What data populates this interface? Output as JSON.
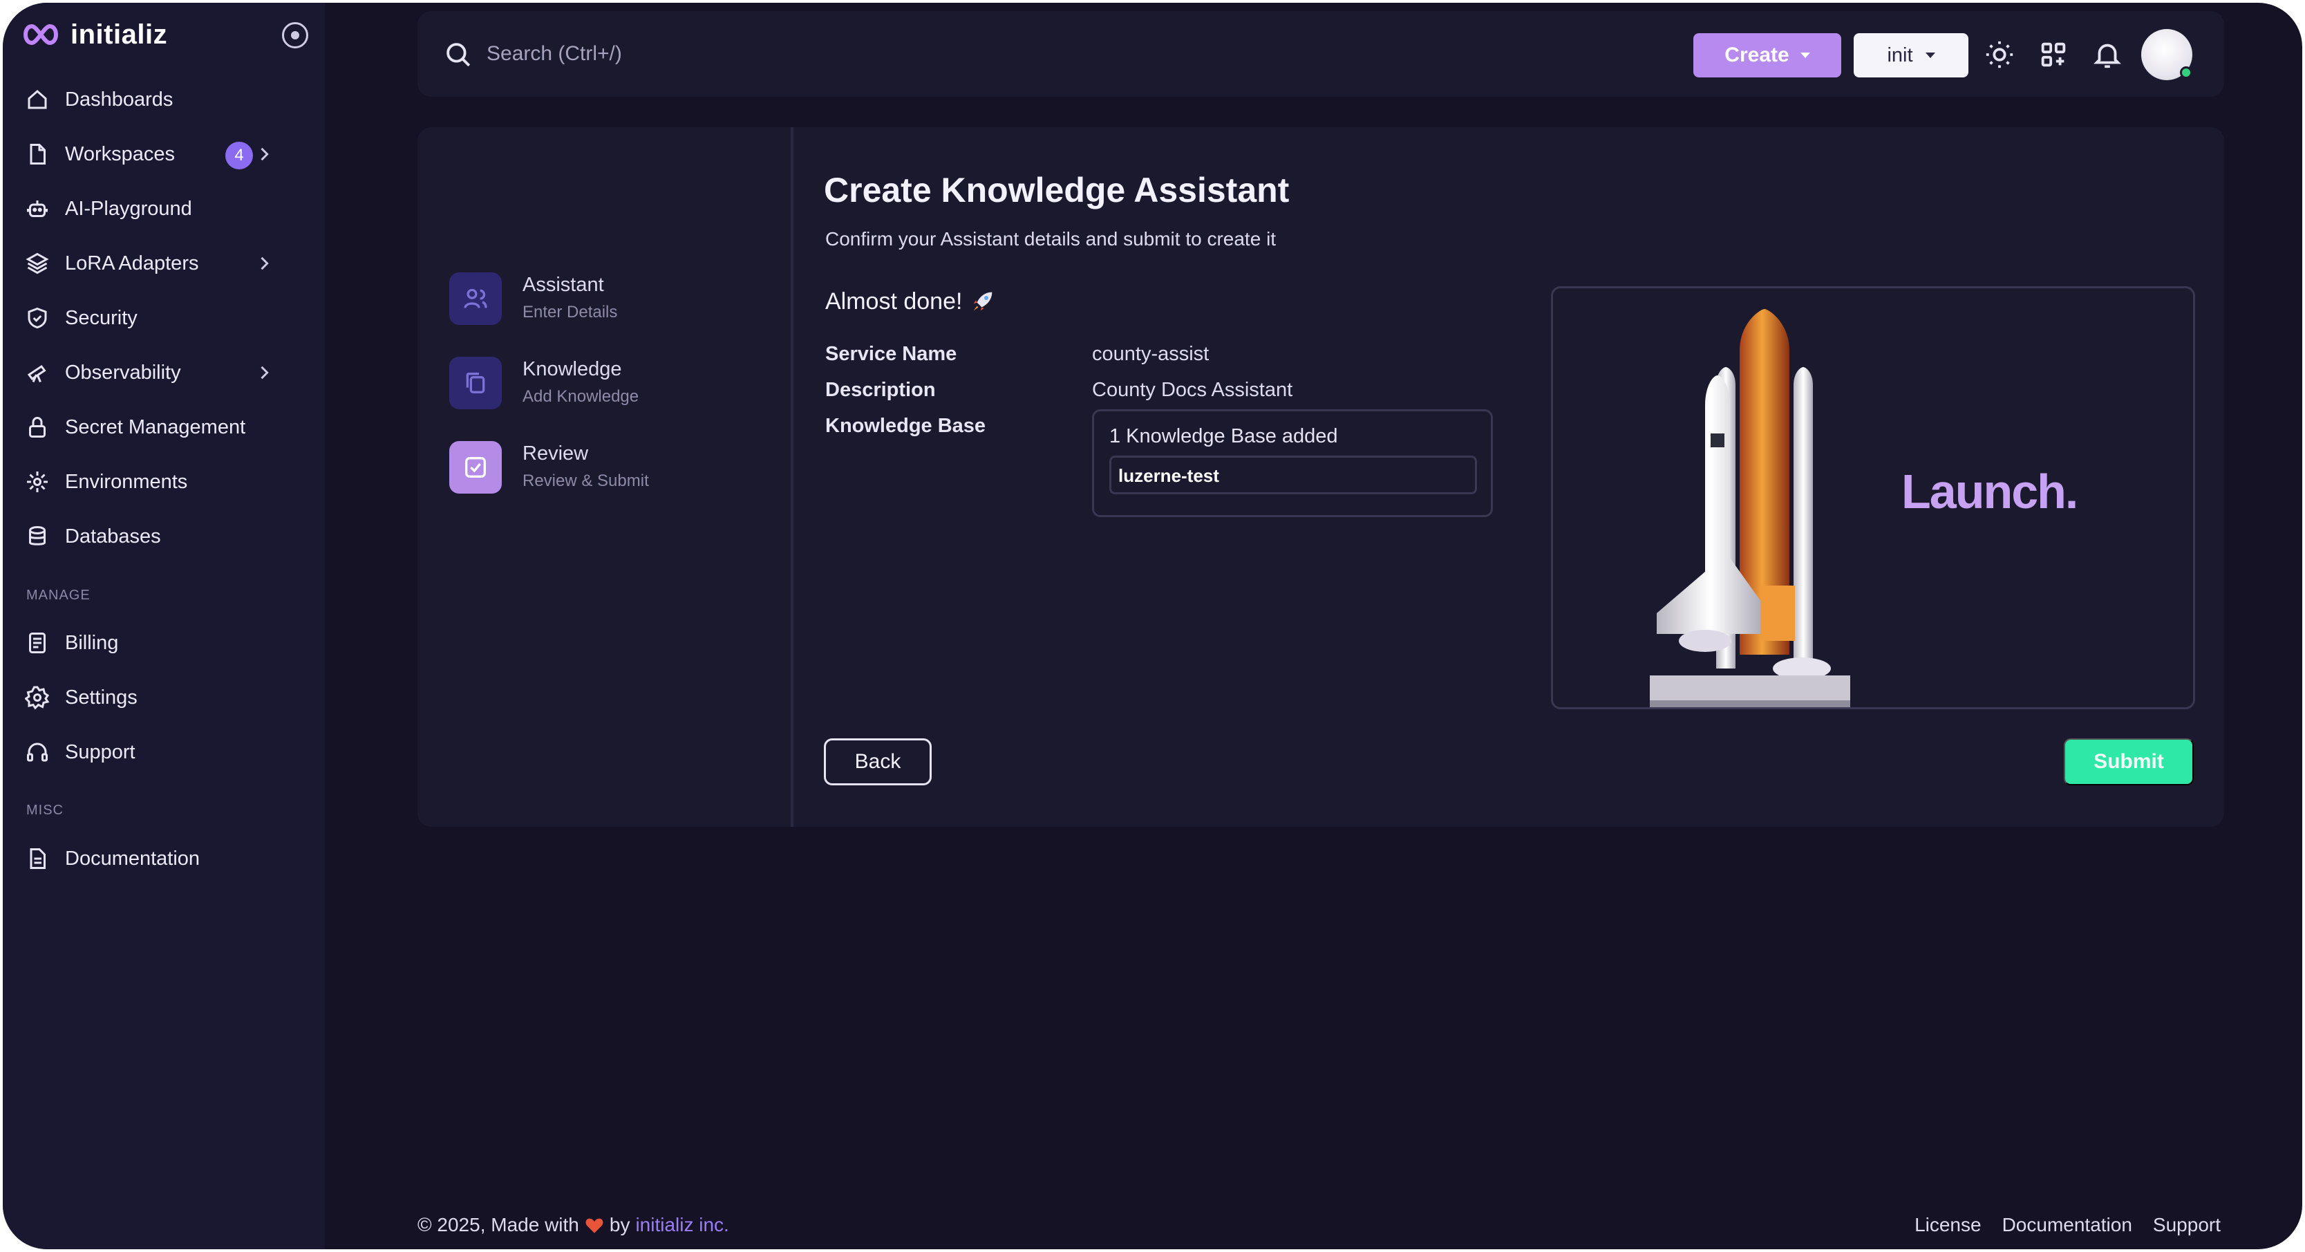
{
  "app": {
    "name": "initializ"
  },
  "sidebar": {
    "items": [
      {
        "label": "Dashboards",
        "icon": "home-icon"
      },
      {
        "label": "Workspaces",
        "icon": "file-icon",
        "badge": "4"
      },
      {
        "label": "AI-Playground",
        "icon": "robot-icon"
      },
      {
        "label": "LoRA Adapters",
        "icon": "layers-icon"
      },
      {
        "label": "Security",
        "icon": "shield-icon"
      },
      {
        "label": "Observability",
        "icon": "telescope-icon"
      },
      {
        "label": "Secret Management",
        "icon": "lock-icon"
      },
      {
        "label": "Environments",
        "icon": "environments-icon"
      },
      {
        "label": "Databases",
        "icon": "database-icon"
      }
    ],
    "manage_label": "MANAGE",
    "manage_items": [
      {
        "label": "Billing",
        "icon": "receipt-icon"
      },
      {
        "label": "Settings",
        "icon": "gear-icon"
      },
      {
        "label": "Support",
        "icon": "headphones-icon"
      }
    ],
    "misc_label": "MISC",
    "misc_items": [
      {
        "label": "Documentation",
        "icon": "document-icon"
      }
    ]
  },
  "topbar": {
    "search_placeholder": "Search (Ctrl+/)",
    "create_label": "Create",
    "workspace_label": "init"
  },
  "stepper": {
    "steps": [
      {
        "title": "Assistant",
        "subtitle": "Enter Details"
      },
      {
        "title": "Knowledge",
        "subtitle": "Add Knowledge"
      },
      {
        "title": "Review",
        "subtitle": "Review & Submit"
      }
    ]
  },
  "main": {
    "title": "Create Knowledge Assistant",
    "subtitle": "Confirm your Assistant details and submit to create it",
    "almost_done": "Almost done!",
    "rows": [
      {
        "label": "Service Name",
        "value": "county-assist"
      },
      {
        "label": "Description",
        "value": "County Docs Assistant"
      },
      {
        "label": "Knowledge Base"
      }
    ],
    "kb_count": "1 Knowledge Base added",
    "kb_item": "luzerne-test",
    "launch_text": "Launch.",
    "back_label": "Back",
    "submit_label": "Submit"
  },
  "footer": {
    "copyright": "© 2025, Made with",
    "by": "by",
    "company": "initializ inc.",
    "links": [
      "License",
      "Documentation",
      "Support"
    ]
  },
  "colors": {
    "background": "#141224",
    "sidebar": "#1a1830",
    "card": "#1b192e",
    "accent_purple": "#b78af0",
    "submit_green": "#2ee8a8",
    "badge_purple": "#8b6cf0"
  }
}
